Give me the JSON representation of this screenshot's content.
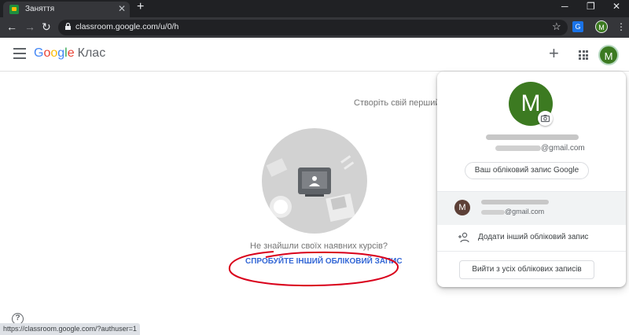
{
  "browser": {
    "tab_title": "Заняття",
    "tab_close": "✕",
    "new_tab": "+",
    "window_controls": {
      "minimize": "─",
      "restore": "❐",
      "close": "✕"
    },
    "nav": {
      "back": "←",
      "forward": "→",
      "reload": "↻"
    },
    "url": "classroom.google.com/u/0/h",
    "star": "☆",
    "translate_glyph": "G",
    "profile_initial": "M",
    "menu": "⋮"
  },
  "app": {
    "logo_letters": [
      "G",
      "o",
      "o",
      "g",
      "l",
      "e"
    ],
    "logo_suffix": "Клас",
    "plus": "+",
    "avatar_initial": "M"
  },
  "main": {
    "create_hint": "Створіть свій перший",
    "no_courses": "Не знайшли своїх наявних курсів?",
    "try_other_account": "СПРОБУЙТЕ ІНШИЙ ОБЛІКОВИЙ ЗАПИС",
    "help": "?",
    "status_url": "https://classroom.google.com/?authuser=1"
  },
  "account_panel": {
    "initial": "M",
    "email_suffix": "@gmail.com",
    "manage_account": "Ваш обліковий запис Google",
    "other_account": {
      "initial": "M",
      "email_suffix": "@gmail.com"
    },
    "add_account": "Додати інший обліковий запис",
    "sign_out_all": "Вийти з усіх облікових записів"
  },
  "colors": {
    "accent": "#3367d6",
    "avatar_green": "#3c7a21",
    "annotation_red": "#d9001b"
  }
}
